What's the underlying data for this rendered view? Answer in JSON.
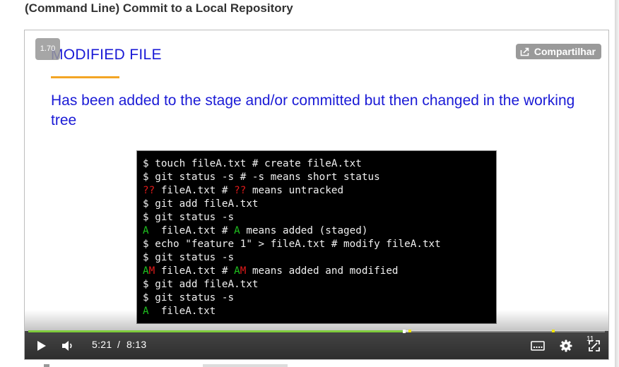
{
  "page": {
    "title": "(Command Line) Commit to a Local Repository"
  },
  "player": {
    "speed": "1.70",
    "share_label": "Compartilhar",
    "current_time": "5:21",
    "time_separator": "/",
    "duration": "8:13",
    "progress_fraction": 0.651,
    "buffered_fraction": 0.66,
    "chapter_number": "11",
    "colors": {
      "progress": "#7fcc3c",
      "marker": "#f2e600"
    }
  },
  "slide": {
    "heading": "MODIFIED FILE",
    "body": "Has been added to the stage and/or committed but then changed in the working tree",
    "colors": {
      "text": "#1a1ad6",
      "underline": "#f3a525"
    }
  },
  "terminal": {
    "lines": [
      {
        "prefix": "",
        "prefix2": "",
        "rest": "$ touch fileA.txt # create fileA.txt"
      },
      {
        "prefix": "",
        "prefix2": "",
        "rest": "$ git status -s # -s means short status"
      },
      {
        "prefix": "??",
        "prefix2": "",
        "mid": " fileA.txt # ",
        "mid_code": "??",
        "rest": " means untracked"
      },
      {
        "prefix": "",
        "prefix2": "",
        "rest": "$ git add fileA.txt"
      },
      {
        "prefix": "",
        "prefix2": "",
        "rest": "$ git status -s"
      },
      {
        "prefix": "A",
        "prefix2": "",
        "mid": "  fileA.txt # ",
        "mid_code": "A",
        "rest": " means added (staged)"
      },
      {
        "prefix": "",
        "prefix2": "",
        "rest": "$ echo \"feature 1\" > fileA.txt # modify fileA.txt"
      },
      {
        "prefix": "",
        "prefix2": "",
        "rest": "$ git status -s"
      },
      {
        "prefix": "A",
        "prefix2": "M",
        "mid": " fileA.txt # ",
        "mid_code": "A",
        "mid_code2": "M",
        "rest": " means added and modified"
      },
      {
        "prefix": "",
        "prefix2": "",
        "rest": "$ git add fileA.txt"
      },
      {
        "prefix": "",
        "prefix2": "",
        "rest": "$ git status -s"
      },
      {
        "prefix": "A",
        "prefix2": "",
        "rest": "  fileA.txt"
      }
    ]
  },
  "controls": {
    "play_icon": "play-icon",
    "volume_icon": "volume-icon",
    "captions_icon": "captions-icon",
    "settings_icon": "gear-icon",
    "fullscreen_icon": "fullscreen-icon"
  }
}
